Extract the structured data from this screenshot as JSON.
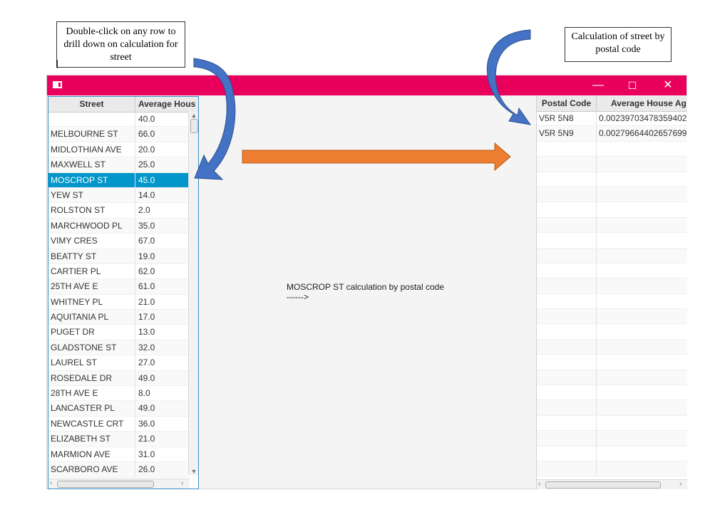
{
  "callouts": {
    "left": "Double-click on any row to drill down on calculation for street",
    "right": "Calculation of street by postal code"
  },
  "window": {
    "controls": {
      "minimize": "—",
      "maximize": "☐",
      "close": "✕"
    },
    "titlebar_color": "#e8005c"
  },
  "left_table": {
    "headers": {
      "street": "Street",
      "avg": "Average Hous"
    },
    "rows": [
      {
        "street": "",
        "avg": "40.0"
      },
      {
        "street": "MELBOURNE ST",
        "avg": "66.0"
      },
      {
        "street": "MIDLOTHIAN AVE",
        "avg": "20.0"
      },
      {
        "street": "MAXWELL ST",
        "avg": "25.0"
      },
      {
        "street": "MOSCROP ST",
        "avg": "45.0",
        "selected": true
      },
      {
        "street": "YEW ST",
        "avg": "14.0"
      },
      {
        "street": "ROLSTON ST",
        "avg": "2.0"
      },
      {
        "street": "MARCHWOOD PL",
        "avg": "35.0"
      },
      {
        "street": "VIMY CRES",
        "avg": "67.0"
      },
      {
        "street": "BEATTY ST",
        "avg": "19.0"
      },
      {
        "street": "CARTIER PL",
        "avg": "62.0"
      },
      {
        "street": "25TH AVE E",
        "avg": "61.0"
      },
      {
        "street": "WHITNEY PL",
        "avg": "21.0"
      },
      {
        "street": "AQUITANIA PL",
        "avg": "17.0"
      },
      {
        "street": "PUGET DR",
        "avg": "13.0"
      },
      {
        "street": "GLADSTONE ST",
        "avg": "32.0"
      },
      {
        "street": "LAUREL ST",
        "avg": "27.0"
      },
      {
        "street": "ROSEDALE DR",
        "avg": "49.0"
      },
      {
        "street": "28TH AVE E",
        "avg": "8.0"
      },
      {
        "street": "LANCASTER PL",
        "avg": "49.0"
      },
      {
        "street": "NEWCASTLE CRT",
        "avg": "36.0"
      },
      {
        "street": "ELIZABETH ST",
        "avg": "21.0"
      },
      {
        "street": "MARMION AVE",
        "avg": "31.0"
      },
      {
        "street": "SCARBORO AVE",
        "avg": "26.0"
      }
    ]
  },
  "middle": {
    "line1": "MOSCROP ST calculation by postal code",
    "line2": "------>"
  },
  "right_table": {
    "headers": {
      "postal": "Postal Code",
      "avg": "Average House Ag"
    },
    "rows": [
      {
        "postal": "V5R 5N8",
        "avg": "0.00239703478359402"
      },
      {
        "postal": "V5R 5N9",
        "avg": "0.00279664402657699"
      }
    ],
    "empty_rows": 22
  },
  "colors": {
    "selected_row": "#0096c9",
    "arrow_blue": "#4472c4",
    "arrow_orange": "#ed7d31"
  }
}
